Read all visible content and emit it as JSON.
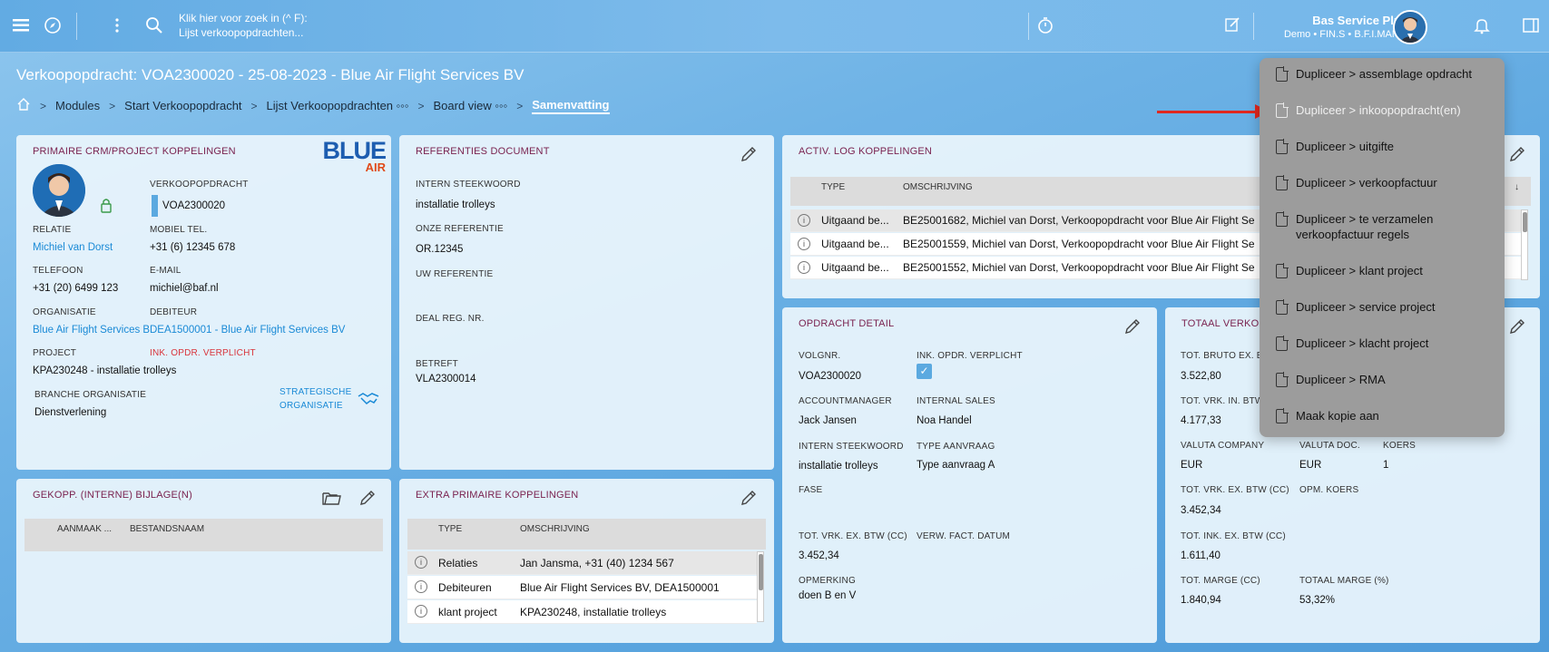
{
  "topbar": {
    "search_line1": "Klik hier voor zoek in (^ F):",
    "search_line2": "Lijst verkoopopdrachten...",
    "user_name": "Bas Service Plus",
    "user_sub": "Demo • FIN.S • B.F.I.MAN..."
  },
  "page": {
    "title": "Verkoopopdracht: VOA2300020 - 25-08-2023 - Blue Air Flight Services BV"
  },
  "breadcrumb": [
    "Modules",
    "Start Verkoopopdracht",
    "Lijst Verkoopopdrachten ◦◦◦",
    "Board view ◦◦◦",
    "Samenvatting"
  ],
  "crm": {
    "title": "PRIMAIRE CRM/PROJECT KOPPELINGEN",
    "logo_line1": "BLUE",
    "logo_line2": "AIR",
    "verkoopopdracht_label": "VERKOOPOPDRACHT",
    "verkoopopdracht": "VOA2300020",
    "relatie_label": "RELATIE",
    "relatie": "Michiel van Dorst",
    "mobiel_label": "MOBIEL TEL.",
    "mobiel": "+31 (6) 12345 678",
    "telefoon_label": "TELEFOON",
    "telefoon": "+31 (20) 6499 123",
    "email_label": "E-MAIL",
    "email": "michiel@baf.nl",
    "organisatie_label": "ORGANISATIE",
    "organisatie": "Blue Air Flight Services B",
    "debiteur_label": "DEBITEUR",
    "debiteur": "DEA1500001 - Blue Air Flight Services BV",
    "project_label": "PROJECT",
    "project": "KPA230248 - installatie trolleys",
    "ink_label": "INK. OPDR. VERPLICHT",
    "branche_label": "BRANCHE ORGANISATIE",
    "branche": "Dienstverlening",
    "strategische_line1": "STRATEGISCHE",
    "strategische_line2": "ORGANISATIE"
  },
  "ref": {
    "title": "REFERENTIES DOCUMENT",
    "intern_label": "INTERN STEEKWOORD",
    "intern": "installatie trolleys",
    "onze_label": "ONZE REFERENTIE",
    "onze": "OR.12345",
    "uw_label": "UW REFERENTIE",
    "deal_label": "DEAL REG. NR.",
    "betreft_label": "BETREFT",
    "betreft": "VLA2300014"
  },
  "activ": {
    "title": "ACTIV. LOG KOPPELINGEN",
    "col_type": "TYPE",
    "col_omschrijving": "OMSCHRIJVING",
    "rows": [
      {
        "type": "Uitgaand be...",
        "omschrijving": "BE25001682, Michiel van Dorst, Verkoopopdracht voor Blue Air Flight Se"
      },
      {
        "type": "Uitgaand be...",
        "omschrijving": "BE25001559, Michiel van Dorst, Verkoopopdracht voor Blue Air Flight Se"
      },
      {
        "type": "Uitgaand be...",
        "omschrijving": "BE25001552, Michiel van Dorst, Verkoopopdracht voor Blue Air Flight Se"
      }
    ]
  },
  "detail": {
    "title": "OPDRACHT DETAIL",
    "volgnr_label": "VOLGNR.",
    "volgnr": "VOA2300020",
    "ink_label": "INK. OPDR. VERPLICHT",
    "am_label": "ACCOUNTMANAGER",
    "am": "Jack Jansen",
    "sales_label": "INTERNAL SALES",
    "sales": "Noa Handel",
    "intern_label": "INTERN STEEKWOORD",
    "intern": "installatie trolleys",
    "type_label": "TYPE AANVRAAG",
    "type": "Type aanvraag A",
    "fase_label": "FASE",
    "totvrk_label": "TOT. VRK. EX. BTW (CC)",
    "totvrk": "3.452,34",
    "verw_label": "VERW. FACT. DATUM",
    "opm_label": "OPMERKING",
    "opm": "doen B en V"
  },
  "totaal": {
    "title": "TOTAAL VERKO",
    "bruto_label": "TOT. BRUTO EX. B",
    "bruto": "3.522,80",
    "vrkin_label": "TOT. VRK. IN. BTW",
    "vrkin": "4.177,33",
    "valcomp_label": "VALUTA COMPANY",
    "valcomp": "EUR",
    "valdoc_label": "VALUTA DOC.",
    "valdoc": "EUR",
    "koers_label": "KOERS",
    "koers": "1",
    "vrkex_label": "TOT. VRK. EX. BTW (CC)",
    "vrkex": "3.452,34",
    "opmkoers_label": "OPM. KOERS",
    "inkex_label": "TOT. INK. EX. BTW (CC)",
    "inkex": "1.611,40",
    "marge_label": "TOT. MARGE (CC)",
    "marge": "1.840,94",
    "margepct_label": "TOTAAL MARGE (%)",
    "margepct": "53,32%"
  },
  "bijlage": {
    "title": "GEKOPP. (INTERNE) BIJLAGE(N)",
    "col1": "AANMAAK ...",
    "col2": "BESTANDSNAAM"
  },
  "extra": {
    "title": "EXTRA PRIMAIRE KOPPELINGEN",
    "col_type": "TYPE",
    "col_omschrijving": "OMSCHRIJVING",
    "rows": [
      {
        "type": "Relaties",
        "omschrijving": "Jan Jansma, +31 (40) 1234 567"
      },
      {
        "type": "Debiteuren",
        "omschrijving": "Blue Air Flight Services BV, DEA1500001"
      },
      {
        "type": "klant project",
        "omschrijving": "KPA230248, installatie trolleys"
      }
    ]
  },
  "menu": [
    "Dupliceer > assemblage opdracht",
    "Dupliceer > inkoopopdracht(en)",
    "Dupliceer > uitgifte",
    "Dupliceer > verkoopfactuur",
    "Dupliceer > te verzamelen verkoopfactuur regels",
    "Dupliceer > klant project",
    "Dupliceer > service project",
    "Dupliceer > klacht project",
    "Dupliceer > RMA",
    "Maak kopie aan"
  ]
}
